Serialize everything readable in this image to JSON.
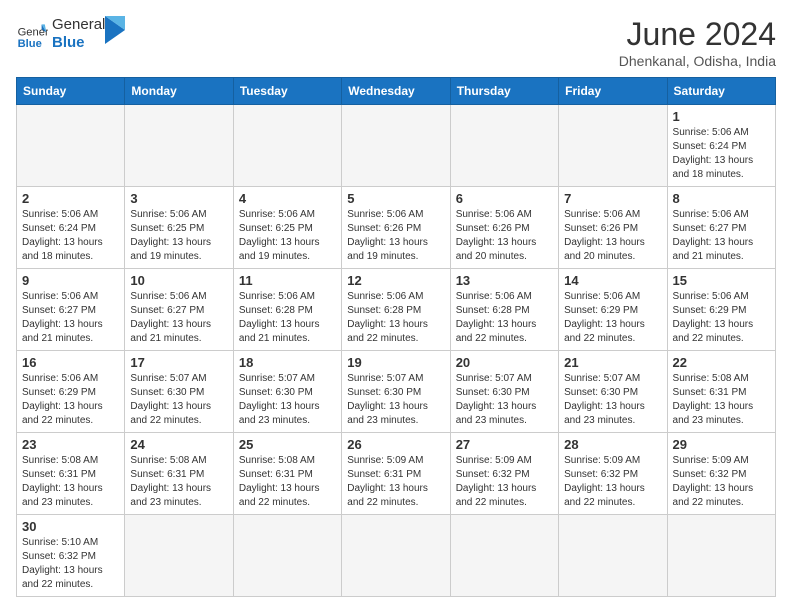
{
  "header": {
    "logo_general": "General",
    "logo_blue": "Blue",
    "month_title": "June 2024",
    "location": "Dhenkanal, Odisha, India"
  },
  "days_of_week": [
    "Sunday",
    "Monday",
    "Tuesday",
    "Wednesday",
    "Thursday",
    "Friday",
    "Saturday"
  ],
  "weeks": [
    [
      {
        "day": "",
        "info": ""
      },
      {
        "day": "",
        "info": ""
      },
      {
        "day": "",
        "info": ""
      },
      {
        "day": "",
        "info": ""
      },
      {
        "day": "",
        "info": ""
      },
      {
        "day": "",
        "info": ""
      },
      {
        "day": "1",
        "info": "Sunrise: 5:06 AM\nSunset: 6:24 PM\nDaylight: 13 hours\nand 18 minutes."
      }
    ],
    [
      {
        "day": "2",
        "info": "Sunrise: 5:06 AM\nSunset: 6:24 PM\nDaylight: 13 hours\nand 18 minutes."
      },
      {
        "day": "3",
        "info": "Sunrise: 5:06 AM\nSunset: 6:25 PM\nDaylight: 13 hours\nand 19 minutes."
      },
      {
        "day": "4",
        "info": "Sunrise: 5:06 AM\nSunset: 6:25 PM\nDaylight: 13 hours\nand 19 minutes."
      },
      {
        "day": "5",
        "info": "Sunrise: 5:06 AM\nSunset: 6:26 PM\nDaylight: 13 hours\nand 19 minutes."
      },
      {
        "day": "6",
        "info": "Sunrise: 5:06 AM\nSunset: 6:26 PM\nDaylight: 13 hours\nand 20 minutes."
      },
      {
        "day": "7",
        "info": "Sunrise: 5:06 AM\nSunset: 6:26 PM\nDaylight: 13 hours\nand 20 minutes."
      },
      {
        "day": "8",
        "info": "Sunrise: 5:06 AM\nSunset: 6:27 PM\nDaylight: 13 hours\nand 21 minutes."
      }
    ],
    [
      {
        "day": "9",
        "info": "Sunrise: 5:06 AM\nSunset: 6:27 PM\nDaylight: 13 hours\nand 21 minutes."
      },
      {
        "day": "10",
        "info": "Sunrise: 5:06 AM\nSunset: 6:27 PM\nDaylight: 13 hours\nand 21 minutes."
      },
      {
        "day": "11",
        "info": "Sunrise: 5:06 AM\nSunset: 6:28 PM\nDaylight: 13 hours\nand 21 minutes."
      },
      {
        "day": "12",
        "info": "Sunrise: 5:06 AM\nSunset: 6:28 PM\nDaylight: 13 hours\nand 22 minutes."
      },
      {
        "day": "13",
        "info": "Sunrise: 5:06 AM\nSunset: 6:28 PM\nDaylight: 13 hours\nand 22 minutes."
      },
      {
        "day": "14",
        "info": "Sunrise: 5:06 AM\nSunset: 6:29 PM\nDaylight: 13 hours\nand 22 minutes."
      },
      {
        "day": "15",
        "info": "Sunrise: 5:06 AM\nSunset: 6:29 PM\nDaylight: 13 hours\nand 22 minutes."
      }
    ],
    [
      {
        "day": "16",
        "info": "Sunrise: 5:06 AM\nSunset: 6:29 PM\nDaylight: 13 hours\nand 22 minutes."
      },
      {
        "day": "17",
        "info": "Sunrise: 5:07 AM\nSunset: 6:30 PM\nDaylight: 13 hours\nand 22 minutes."
      },
      {
        "day": "18",
        "info": "Sunrise: 5:07 AM\nSunset: 6:30 PM\nDaylight: 13 hours\nand 23 minutes."
      },
      {
        "day": "19",
        "info": "Sunrise: 5:07 AM\nSunset: 6:30 PM\nDaylight: 13 hours\nand 23 minutes."
      },
      {
        "day": "20",
        "info": "Sunrise: 5:07 AM\nSunset: 6:30 PM\nDaylight: 13 hours\nand 23 minutes."
      },
      {
        "day": "21",
        "info": "Sunrise: 5:07 AM\nSunset: 6:30 PM\nDaylight: 13 hours\nand 23 minutes."
      },
      {
        "day": "22",
        "info": "Sunrise: 5:08 AM\nSunset: 6:31 PM\nDaylight: 13 hours\nand 23 minutes."
      }
    ],
    [
      {
        "day": "23",
        "info": "Sunrise: 5:08 AM\nSunset: 6:31 PM\nDaylight: 13 hours\nand 23 minutes."
      },
      {
        "day": "24",
        "info": "Sunrise: 5:08 AM\nSunset: 6:31 PM\nDaylight: 13 hours\nand 23 minutes."
      },
      {
        "day": "25",
        "info": "Sunrise: 5:08 AM\nSunset: 6:31 PM\nDaylight: 13 hours\nand 22 minutes."
      },
      {
        "day": "26",
        "info": "Sunrise: 5:09 AM\nSunset: 6:31 PM\nDaylight: 13 hours\nand 22 minutes."
      },
      {
        "day": "27",
        "info": "Sunrise: 5:09 AM\nSunset: 6:32 PM\nDaylight: 13 hours\nand 22 minutes."
      },
      {
        "day": "28",
        "info": "Sunrise: 5:09 AM\nSunset: 6:32 PM\nDaylight: 13 hours\nand 22 minutes."
      },
      {
        "day": "29",
        "info": "Sunrise: 5:09 AM\nSunset: 6:32 PM\nDaylight: 13 hours\nand 22 minutes."
      }
    ],
    [
      {
        "day": "30",
        "info": "Sunrise: 5:10 AM\nSunset: 6:32 PM\nDaylight: 13 hours\nand 22 minutes."
      },
      {
        "day": "",
        "info": ""
      },
      {
        "day": "",
        "info": ""
      },
      {
        "day": "",
        "info": ""
      },
      {
        "day": "",
        "info": ""
      },
      {
        "day": "",
        "info": ""
      },
      {
        "day": "",
        "info": ""
      }
    ]
  ]
}
